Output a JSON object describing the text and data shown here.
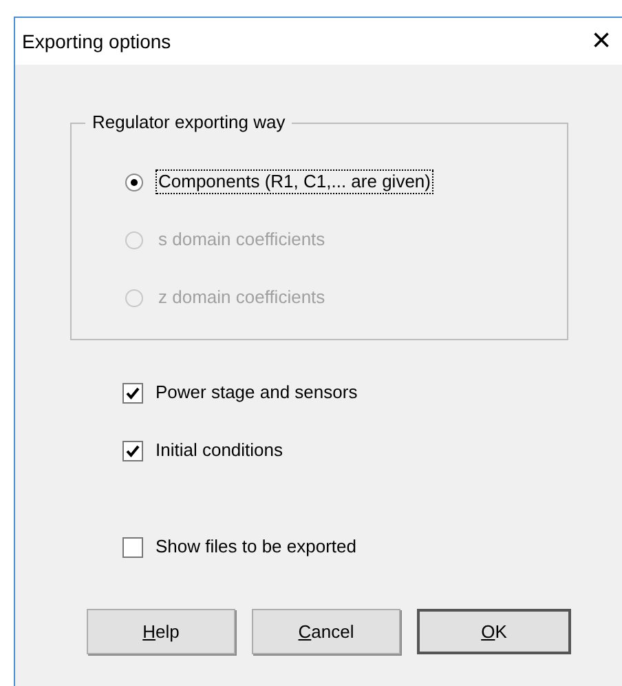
{
  "window": {
    "title": "Exporting options",
    "close": "×"
  },
  "group": {
    "title": "Regulator exporting way",
    "options": [
      {
        "label": "Components (R1, C1,... are given)",
        "selected": true,
        "disabled": false,
        "focused": true
      },
      {
        "label": "s domain coefficients",
        "selected": false,
        "disabled": true,
        "focused": false
      },
      {
        "label": "z domain coefficients",
        "selected": false,
        "disabled": true,
        "focused": false
      }
    ]
  },
  "checkboxes": [
    {
      "label": "Power stage and sensors",
      "checked": true
    },
    {
      "label": "Initial conditions",
      "checked": true
    },
    {
      "label": "Show files to be exported",
      "checked": false
    }
  ],
  "buttons": [
    {
      "accel": "H",
      "rest": "elp",
      "default": false
    },
    {
      "accel": "C",
      "rest": "ancel",
      "default": false
    },
    {
      "accel": "O",
      "rest": "K",
      "default": true
    }
  ]
}
